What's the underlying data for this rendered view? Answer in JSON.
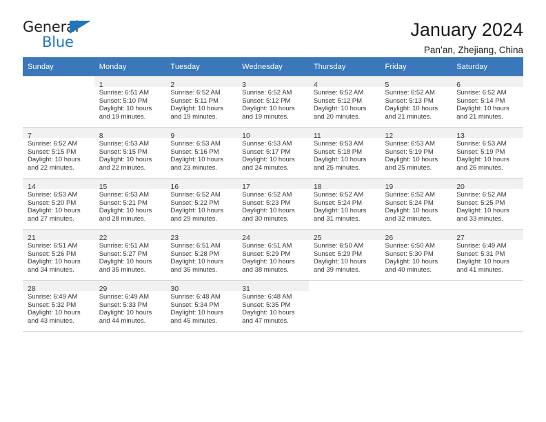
{
  "brand": {
    "name_top": "General",
    "name_bottom": "Blue",
    "triangle_color": "#1f76bd",
    "text_color": "#231f20"
  },
  "header": {
    "title": "January 2024",
    "subtitle": "Pan’an, Zhejiang, China"
  },
  "theme": {
    "header_row_bg": "#3a77bb",
    "header_row_text": "#ffffff",
    "daynum_band_bg": "#f1f1f1",
    "cell_border": "#d4d4d4"
  },
  "weekdays": [
    "Sunday",
    "Monday",
    "Tuesday",
    "Wednesday",
    "Thursday",
    "Friday",
    "Saturday"
  ],
  "weeks": [
    [
      {
        "day": "",
        "sunrise": "",
        "sunset": "",
        "daylight1": "",
        "daylight2": ""
      },
      {
        "day": "1",
        "sunrise": "Sunrise: 6:51 AM",
        "sunset": "Sunset: 5:10 PM",
        "daylight1": "Daylight: 10 hours",
        "daylight2": "and 19 minutes."
      },
      {
        "day": "2",
        "sunrise": "Sunrise: 6:52 AM",
        "sunset": "Sunset: 5:11 PM",
        "daylight1": "Daylight: 10 hours",
        "daylight2": "and 19 minutes."
      },
      {
        "day": "3",
        "sunrise": "Sunrise: 6:52 AM",
        "sunset": "Sunset: 5:12 PM",
        "daylight1": "Daylight: 10 hours",
        "daylight2": "and 19 minutes."
      },
      {
        "day": "4",
        "sunrise": "Sunrise: 6:52 AM",
        "sunset": "Sunset: 5:12 PM",
        "daylight1": "Daylight: 10 hours",
        "daylight2": "and 20 minutes."
      },
      {
        "day": "5",
        "sunrise": "Sunrise: 6:52 AM",
        "sunset": "Sunset: 5:13 PM",
        "daylight1": "Daylight: 10 hours",
        "daylight2": "and 21 minutes."
      },
      {
        "day": "6",
        "sunrise": "Sunrise: 6:52 AM",
        "sunset": "Sunset: 5:14 PM",
        "daylight1": "Daylight: 10 hours",
        "daylight2": "and 21 minutes."
      }
    ],
    [
      {
        "day": "7",
        "sunrise": "Sunrise: 6:52 AM",
        "sunset": "Sunset: 5:15 PM",
        "daylight1": "Daylight: 10 hours",
        "daylight2": "and 22 minutes."
      },
      {
        "day": "8",
        "sunrise": "Sunrise: 6:53 AM",
        "sunset": "Sunset: 5:15 PM",
        "daylight1": "Daylight: 10 hours",
        "daylight2": "and 22 minutes."
      },
      {
        "day": "9",
        "sunrise": "Sunrise: 6:53 AM",
        "sunset": "Sunset: 5:16 PM",
        "daylight1": "Daylight: 10 hours",
        "daylight2": "and 23 minutes."
      },
      {
        "day": "10",
        "sunrise": "Sunrise: 6:53 AM",
        "sunset": "Sunset: 5:17 PM",
        "daylight1": "Daylight: 10 hours",
        "daylight2": "and 24 minutes."
      },
      {
        "day": "11",
        "sunrise": "Sunrise: 6:53 AM",
        "sunset": "Sunset: 5:18 PM",
        "daylight1": "Daylight: 10 hours",
        "daylight2": "and 25 minutes."
      },
      {
        "day": "12",
        "sunrise": "Sunrise: 6:53 AM",
        "sunset": "Sunset: 5:19 PM",
        "daylight1": "Daylight: 10 hours",
        "daylight2": "and 25 minutes."
      },
      {
        "day": "13",
        "sunrise": "Sunrise: 6:53 AM",
        "sunset": "Sunset: 5:19 PM",
        "daylight1": "Daylight: 10 hours",
        "daylight2": "and 26 minutes."
      }
    ],
    [
      {
        "day": "14",
        "sunrise": "Sunrise: 6:53 AM",
        "sunset": "Sunset: 5:20 PM",
        "daylight1": "Daylight: 10 hours",
        "daylight2": "and 27 minutes."
      },
      {
        "day": "15",
        "sunrise": "Sunrise: 6:53 AM",
        "sunset": "Sunset: 5:21 PM",
        "daylight1": "Daylight: 10 hours",
        "daylight2": "and 28 minutes."
      },
      {
        "day": "16",
        "sunrise": "Sunrise: 6:52 AM",
        "sunset": "Sunset: 5:22 PM",
        "daylight1": "Daylight: 10 hours",
        "daylight2": "and 29 minutes."
      },
      {
        "day": "17",
        "sunrise": "Sunrise: 6:52 AM",
        "sunset": "Sunset: 5:23 PM",
        "daylight1": "Daylight: 10 hours",
        "daylight2": "and 30 minutes."
      },
      {
        "day": "18",
        "sunrise": "Sunrise: 6:52 AM",
        "sunset": "Sunset: 5:24 PM",
        "daylight1": "Daylight: 10 hours",
        "daylight2": "and 31 minutes."
      },
      {
        "day": "19",
        "sunrise": "Sunrise: 6:52 AM",
        "sunset": "Sunset: 5:24 PM",
        "daylight1": "Daylight: 10 hours",
        "daylight2": "and 32 minutes."
      },
      {
        "day": "20",
        "sunrise": "Sunrise: 6:52 AM",
        "sunset": "Sunset: 5:25 PM",
        "daylight1": "Daylight: 10 hours",
        "daylight2": "and 33 minutes."
      }
    ],
    [
      {
        "day": "21",
        "sunrise": "Sunrise: 6:51 AM",
        "sunset": "Sunset: 5:26 PM",
        "daylight1": "Daylight: 10 hours",
        "daylight2": "and 34 minutes."
      },
      {
        "day": "22",
        "sunrise": "Sunrise: 6:51 AM",
        "sunset": "Sunset: 5:27 PM",
        "daylight1": "Daylight: 10 hours",
        "daylight2": "and 35 minutes."
      },
      {
        "day": "23",
        "sunrise": "Sunrise: 6:51 AM",
        "sunset": "Sunset: 5:28 PM",
        "daylight1": "Daylight: 10 hours",
        "daylight2": "and 36 minutes."
      },
      {
        "day": "24",
        "sunrise": "Sunrise: 6:51 AM",
        "sunset": "Sunset: 5:29 PM",
        "daylight1": "Daylight: 10 hours",
        "daylight2": "and 38 minutes."
      },
      {
        "day": "25",
        "sunrise": "Sunrise: 6:50 AM",
        "sunset": "Sunset: 5:29 PM",
        "daylight1": "Daylight: 10 hours",
        "daylight2": "and 39 minutes."
      },
      {
        "day": "26",
        "sunrise": "Sunrise: 6:50 AM",
        "sunset": "Sunset: 5:30 PM",
        "daylight1": "Daylight: 10 hours",
        "daylight2": "and 40 minutes."
      },
      {
        "day": "27",
        "sunrise": "Sunrise: 6:49 AM",
        "sunset": "Sunset: 5:31 PM",
        "daylight1": "Daylight: 10 hours",
        "daylight2": "and 41 minutes."
      }
    ],
    [
      {
        "day": "28",
        "sunrise": "Sunrise: 6:49 AM",
        "sunset": "Sunset: 5:32 PM",
        "daylight1": "Daylight: 10 hours",
        "daylight2": "and 43 minutes."
      },
      {
        "day": "29",
        "sunrise": "Sunrise: 6:49 AM",
        "sunset": "Sunset: 5:33 PM",
        "daylight1": "Daylight: 10 hours",
        "daylight2": "and 44 minutes."
      },
      {
        "day": "30",
        "sunrise": "Sunrise: 6:48 AM",
        "sunset": "Sunset: 5:34 PM",
        "daylight1": "Daylight: 10 hours",
        "daylight2": "and 45 minutes."
      },
      {
        "day": "31",
        "sunrise": "Sunrise: 6:48 AM",
        "sunset": "Sunset: 5:35 PM",
        "daylight1": "Daylight: 10 hours",
        "daylight2": "and 47 minutes."
      },
      {
        "day": "",
        "sunrise": "",
        "sunset": "",
        "daylight1": "",
        "daylight2": ""
      },
      {
        "day": "",
        "sunrise": "",
        "sunset": "",
        "daylight1": "",
        "daylight2": ""
      },
      {
        "day": "",
        "sunrise": "",
        "sunset": "",
        "daylight1": "",
        "daylight2": ""
      }
    ]
  ]
}
